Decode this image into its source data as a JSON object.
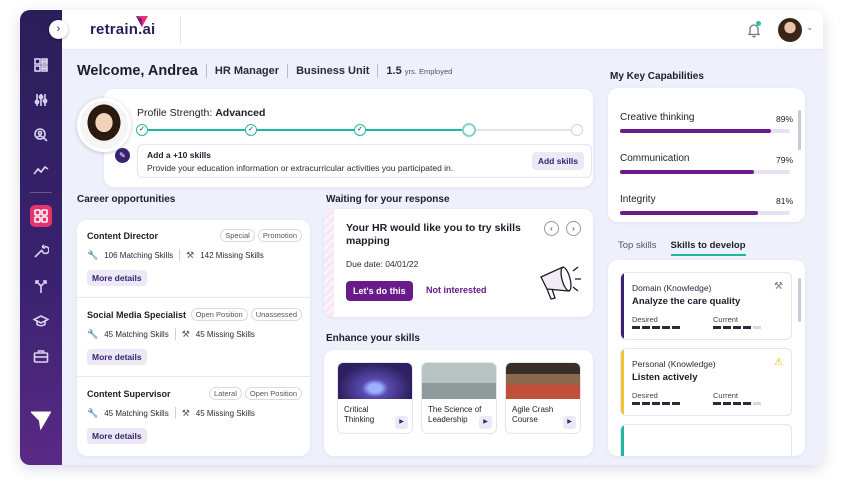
{
  "app": {
    "logo_text": "retrain.ai"
  },
  "welcome": {
    "greeting": "Welcome, Andrea",
    "role": "HR Manager",
    "unit": "Business Unit",
    "years": "1.5",
    "years_suffix": "yrs. Employed"
  },
  "profile": {
    "strength_label": "Profile Strength:",
    "strength_value": "Advanced",
    "tip_title": "Add a +10 skills",
    "tip_text": "Provide your education information or extracurricular activities you participated in.",
    "tip_button": "Add skills"
  },
  "sections": {
    "career": "Career opportunities",
    "waiting": "Waiting for your response",
    "enhance": "Enhance your skills",
    "capabilities": "My Key Capabilities"
  },
  "jobs": [
    {
      "title": "Content Director",
      "tags": [
        "Special",
        "Promotion"
      ],
      "matching": "106 Matching Skills",
      "missing": "142 Missing Skills",
      "button": "More details"
    },
    {
      "title": "Social Media Specialist",
      "tags": [
        "Open Position",
        "Unassessed"
      ],
      "matching": "45 Matching Skills",
      "missing": "45 Missing Skills",
      "button": "More details"
    },
    {
      "title": "Content Supervisor",
      "tags": [
        "Lateral",
        "Open Position"
      ],
      "matching": "45 Matching Skills",
      "missing": "45 Missing Skills",
      "button": "More details"
    }
  ],
  "waiting": {
    "title": "Your HR would like you to try skills mapping",
    "due": "Due date: 04/01/22",
    "primary": "Let's do this",
    "secondary": "Not interested",
    "prev_icon": "chevron-left-icon",
    "next_icon": "chevron-right-icon"
  },
  "courses": [
    {
      "title": "Critical Thinking",
      "color": "#4a3a8a"
    },
    {
      "title": "The Science of Leadership",
      "color": "#9aa6a8"
    },
    {
      "title": "Agile Crash Course",
      "color": "#6a5a4a"
    }
  ],
  "capabilities": [
    {
      "name": "Creative thinking",
      "percent": "89%",
      "value": 0.89
    },
    {
      "name": "Communication",
      "percent": "79%",
      "value": 0.79
    },
    {
      "name": "Integrity",
      "percent": "81%",
      "value": 0.81
    }
  ],
  "skill_tabs": {
    "top": "Top skills",
    "develop": "Skills to develop"
  },
  "skills_to_develop": [
    {
      "category": "Domain (Knowledge)",
      "name": "Analyze the care quality",
      "desired_label": "Desired",
      "current_label": "Current",
      "desired": 5,
      "current": 4,
      "accent": "#3a2270",
      "icon": "tools-icon"
    },
    {
      "category": "Personal (Knowledge)",
      "name": "Listen actively",
      "desired_label": "Desired",
      "current_label": "Current",
      "desired": 5,
      "current": 4,
      "accent": "#f4c430",
      "icon": "warning-icon"
    }
  ],
  "colors": {
    "accent": "#6a1a8a",
    "teal": "#1fb89e",
    "sidebar": "#2a1e59",
    "active_nav": "#e8336d"
  }
}
